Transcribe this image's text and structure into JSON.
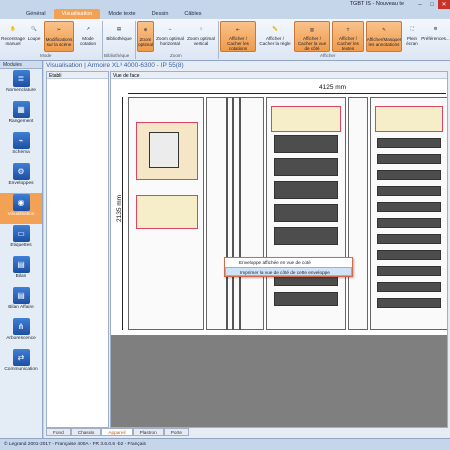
{
  "window": {
    "title": "TGBT IS - Nouveau te"
  },
  "tabs": [
    "Général",
    "Visualisation",
    "Mode texte",
    "Dessin",
    "Câbles"
  ],
  "ribbon": {
    "buttons": [
      {
        "label": "Recentrage manuel",
        "icon": "hand-icon"
      },
      {
        "label": "Loupe",
        "icon": "magnifier-icon"
      },
      {
        "label": "Modifications sur la scène",
        "icon": "tools-icon"
      },
      {
        "label": "Mode cotation",
        "icon": "dimension-icon"
      },
      {
        "label": "Bibliothèque",
        "icon": "library-icon"
      },
      {
        "label": "Zoom optimal",
        "icon": "zoom-icon"
      },
      {
        "label": "Zoom optimal horizontal",
        "icon": "zoom-h-icon"
      },
      {
        "label": "Zoom optimal vertical",
        "icon": "zoom-v-icon"
      },
      {
        "label": "Afficher / Cacher les cotations",
        "icon": "show-dims-icon"
      },
      {
        "label": "Afficher / Cacher la règle",
        "icon": "ruler-icon"
      },
      {
        "label": "Afficher / Cacher la vue de côté",
        "icon": "side-view-icon"
      },
      {
        "label": "Afficher / Cacher les textes",
        "icon": "texts-icon"
      },
      {
        "label": "Afficher/Masquer les annotations",
        "icon": "annotations-icon"
      },
      {
        "label": "Plein écran",
        "icon": "fullscreen-icon"
      },
      {
        "label": "Préférences...",
        "icon": "preferences-icon"
      }
    ],
    "groups": [
      "Mode",
      "Bibliothèque",
      "Zoom",
      "Afficher"
    ]
  },
  "sidebar": {
    "header": "Modules",
    "items": [
      "Nomenclature",
      "Rangement",
      "Schéma",
      "Enveloppes",
      "Visualisation",
      "Etiquettes",
      "Bilan",
      "Bilan Affaire",
      "Arborescence",
      "Communication"
    ]
  },
  "main": {
    "breadcrumb": "Visualisation | Armoire XL³ 4000-6300 - IP 55(8)",
    "left_header": "Etabli",
    "view_header": "Vue de face",
    "dim_width": "4125 mm",
    "dim_height": "2135 mm"
  },
  "context_menu": [
    "Enveloppe affichée en vue de coté",
    "Imprimer la vue de côté de cette enveloppe"
  ],
  "bottom_tabs": [
    "Fond",
    "Chassis",
    "Appareil",
    "Plastron",
    "Porte"
  ],
  "status": "© Legrand 2001-2017 - Française 400A - FR 3.6.0.6 -b2 - Français",
  "colors": {
    "accent": "#f3a255",
    "ribbon_blue": "#c5d5ea"
  }
}
